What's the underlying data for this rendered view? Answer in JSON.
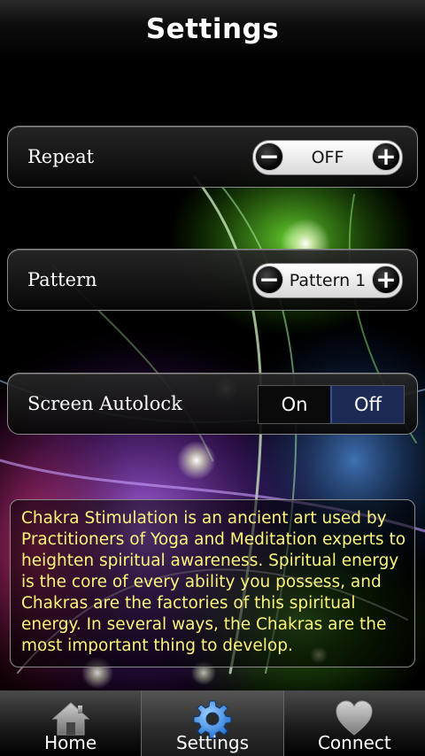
{
  "header": {
    "title": "Settings"
  },
  "settings": {
    "repeat": {
      "label": "Repeat",
      "value": "OFF"
    },
    "pattern": {
      "label": "Pattern",
      "value": "Pattern 1"
    },
    "autolock": {
      "label": "Screen Autolock",
      "on_label": "On",
      "off_label": "Off",
      "selected": "Off"
    }
  },
  "description": "Chakra Stimulation is an ancient art used by Practitioners of Yoga and Meditation experts to heighten spiritual awareness. Spiritual energy is the core of every ability you possess, and Chakras are the factories of this spiritual energy. In several ways, the Chakras are the most important thing to develop.",
  "tabs": [
    {
      "label": "Home",
      "icon": "home-icon"
    },
    {
      "label": "Settings",
      "icon": "gear-icon",
      "active": true
    },
    {
      "label": "Connect",
      "icon": "heart-icon"
    }
  ],
  "colors": {
    "description_text": "#fbf37a",
    "toggle_selected": "#1d2a55"
  }
}
